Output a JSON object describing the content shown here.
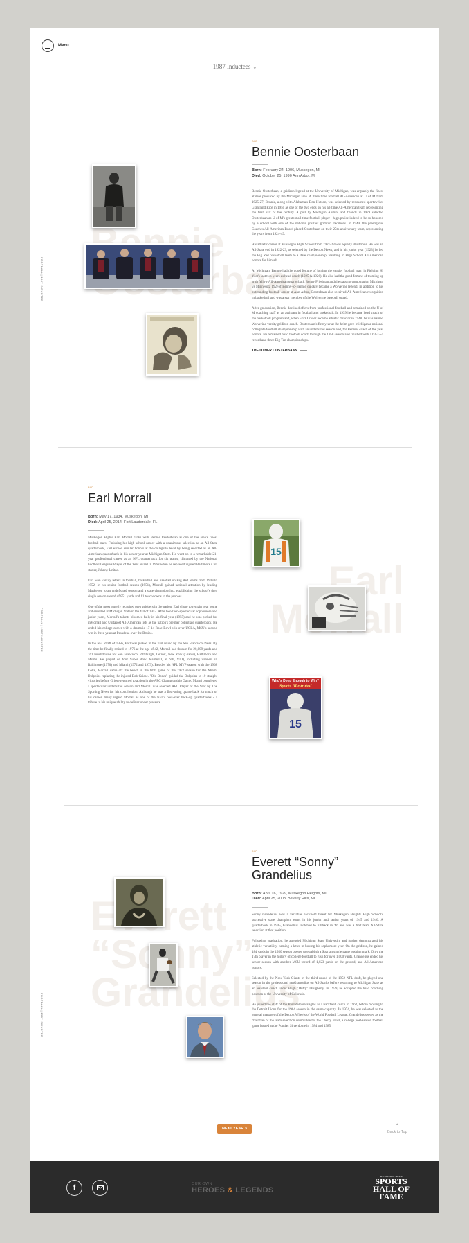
{
  "menu": {
    "label": "Menu"
  },
  "class_selector": {
    "label": "1987 Inductees"
  },
  "inductees": [
    {
      "tag": "BIO",
      "name": "Bennie Oosterbaan",
      "ghost": "Bennie\nOosterbaan",
      "born_label": "Born:",
      "born": "February 24, 1906, Muskegon, MI",
      "died_label": "Died:",
      "died": "October 25, 1990 Ann Arbor, MI",
      "side_label": "FOOTBALL | 1987 INDUCTEE",
      "bio": [
        "Bennie Oosterbaan, a gridiron legend at the University of Michigan, was arguably the finest athlete produced by the Michigan area. A three time football All-American at U of M from 1925-27, Bennie, along with Alabama's Don Hutson, was selected by renowned sportswriter Grantland Rice in 1950 as one of the two ends on his all-time All-American team representing the first half of the century. A poll by Michigan Alumni and friends in 1979 selected Oosterbaan as U of M's greatest all-time football player - high praise indeed to be so honored by a school with one of the nation's greatest gridiron traditions. In 1949, the prestigious Coaches All-American Board placed Oosterbaan on their 25th anniversary team, representing the years from 1924-49.",
        "His athletic career at Muskegon High School from 1921-23 was equally illustrious. He was an All-State end in 1922-23, as selected by the Detroit News, and in his junior year (1923) he led the Big Red basketball team to a state championship, resulting in High School All-American honors for himself.",
        "At Michigan, Bennie had the good fortune of joining the varsity football team in Fielding H. Yost's last two years as head coach (1925 & 1926). He also had the good fortune of teaming up with fellow All-American quarterback Benny Friedman and the passing combination Michigan vs Minnesota 1927of Benny-to-Bennie quickly became a Wolverine legend. In addition to his outstanding football career at Ann Arbor, Oosterbaan also received All-American recognition in basketball and was a star member of the Wolverine baseball squad.",
        "After graduation, Bennie declined offers from professional football and remained on the U of M coaching staff as an assistant in football and basketball. In 1939 he became head coach of the basketball program and, when Fritz Crisler became athletic director in 1948, he was named Wolverine varsity gridiron coach. Oosterbaan's first year at the helm gave Michigan a national collegiate football championship with an undefeated season and, for Bennie, coach of the year honors. He remained head football coach through the 1958 season and finished with a 63-33-4 record and three Big Ten championships."
      ],
      "link": "THE OTHER OOSTERBAAN"
    },
    {
      "tag": "BIO",
      "name": "Earl Morrall",
      "ghost": "Earl\nMorrall",
      "born_label": "Born:",
      "born": "May 17, 1934, Muskegon, MI",
      "died_label": "Died:",
      "died": "April 25, 2014, Fort Lauderdale, FL",
      "side_label": "FOOTBALL | 1987 INDUCTEE",
      "bio": [
        "Muskegon High's Earl Morrall ranks with Bennie Oosterbaan as one of the area's finest football stars. Finishing his high school career with a unanimous selection as an All-State quarterback, Earl earned similar honors at the collegiate level by being selected as an All-American quarterback in his senior year at Michigan State. He went on to a remarkable 21-year professional career as an NFL quarterback for six teams, climaxed by the National Football League's Player of the Year award in 1968 when he replaced injured Baltimore Colt starter, Johnny Unitas.",
        "Earl won varsity letters in football, basketball and baseball on Big Red teams from 1949 to 1952. In his senior football season (1951), Morrall gained national attention by leading Muskegon to an undefeated season and a state championship, establishing the school's then single season record of 851 yards and 11 touchdowns in the process.",
        "One of the most eagerly recruited prep gridders in the nation, Earl chose to remain near home and enrolled at Michigan State in the fall of 1952. After two-then-spectacular sophomore and junior years, Morrall's talents bloomed fully in his final year (1955) and he was picked for mMorrall and Unitasost All-American lists as the nation's premier collegiate quarterback. He ended his college career with a dramatic 17-14 Rose Bowl win over UCLA, MSU's second win in three years at Pasadena over the Bruins.",
        "In the NFL draft of 1956, Earl was picked in the first round by the San Francisco 49ers. By the time he finally retired in 1976 at the age of 42, Morrall had thrown for 20,809 yards and 161 touchdowns for San Francisco, Pittsburgh, Detroit, New York (Giants), Baltimore and Miami. He played on four Super Bowl teams(III, V, VII, VIII), including winners in Baltimore (1970) and Miami (1972 and 1973). Besides his NFL MVP season with the 1968 Colts, Morrall came off the bench in the fifth game of the 1972 season for the Miami Dolphins replacing the injured Bob Griese. \"Old Bones\" guided the Dolphins to 10 straight victories before Griese returned to action in the AFC Championship Game. Miami completed a spectacular undefeated season and Morrall was selected AFC Player of the Year by The Sporting News for his contribution. Although he was a first-string quarterback for much of his career, many regard Morrall as one of the NFL's best-ever back-up quarterbacks - a tribute to his unique ability to deliver under pressure"
      ]
    },
    {
      "tag": "BIO",
      "name": "Everett “Sonny” Grandelius",
      "ghost": "Everett\n“Sonny”\nGrandelius",
      "born_label": "Born:",
      "born": "April 16, 1929, Muskegon Heights, MI",
      "died_label": "Died:",
      "died": "April 25, 2008, Beverly Hills, MI",
      "side_label": "FOOTBALL | 1987 INDUCTEE",
      "bio": [
        "Sonny Grandelius was a versatile backfield threat for Muskegon Heights High School's successive state champion teams in his junior and senior years of 1945 and 1946. A quarterback in 1945, Grandelius switched to fullback in '46 and was a first team All-State selection at that position.",
        "Following graduation, he attended Michigan State University and further demonstrated his athletic versatility, earning a letter in boxing his sophomore year. On the gridiron, he gained 184 yards in the 1950 season opener to establish a Spartan single game rushing mark. Only the 17th player in the history of college football to rush for over 1,000 yards, Grandelius ended his senior season with another MSU record of 1,023 yards on the ground, and All-American honors.",
        "Selected by the New York Giants in the third round of the 1952 NFL draft, he played one season in the professional ranGrandelius on All-Starks before returning to Michigan State as an assistant coach under Hugh \"Duffy\" Daugherty. In 1959, he accepted the head coaching position at the University of Colorado.",
        "He joined the staff of the Philadelphia Eagles as a backfield coach in 1962, before moving to the Detroit Lions for the 1964 season in the same capacity. In 1974, he was selected as the general manager of the Detroit Wheels of the World Football League. Grandelius served as the chairman of the team selection committee for the Cherry Bowl, a college post-season football game hosted at the Pontiac Silverdome in 1984 and 1985."
      ]
    }
  ],
  "magazine": {
    "headline": "Who's Deep Enough to Win?",
    "title": "Sports Illustrated",
    "number": "15"
  },
  "jersey_number": "15",
  "next_button": "NEXT YEAR >",
  "back_to_top": "Back to Top",
  "footer": {
    "tag_small": "OUR OWN",
    "tag_big_1": "HEROES",
    "tag_amp": "&",
    "tag_big_2": "LEGENDS",
    "logo_line1": "MUSKEGON AREA",
    "logo_line2": "SPORTS",
    "logo_line3": "HALL OF",
    "logo_line4": "FAME"
  },
  "colors": {
    "accent": "#d9843a",
    "footer_bg": "#2b2b2b",
    "page_bg": "#d2d1cc",
    "ghost_text": "#f3efeb"
  }
}
